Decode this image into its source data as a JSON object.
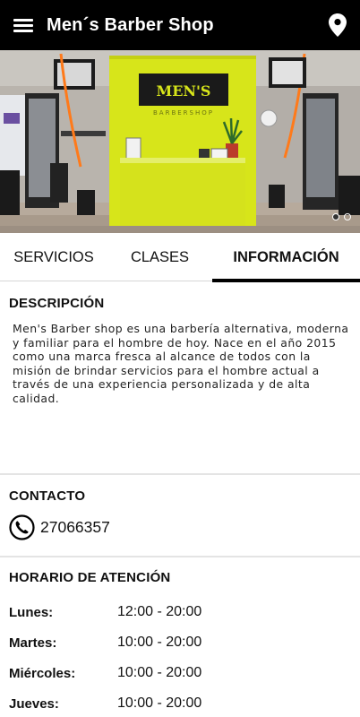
{
  "app": {
    "title": "Men´s Barber Shop"
  },
  "icons": {
    "menu": "menu-icon",
    "location": "location-pin-icon",
    "phone": "phone-icon"
  },
  "hero": {
    "logo_text": "MEN'S",
    "logo_sub": "BARBERSHOP",
    "slides": 2,
    "active_slide": 1,
    "accent": "#d7e51a"
  },
  "tabs": [
    {
      "label": "SERVICIOS"
    },
    {
      "label": "CLASES"
    },
    {
      "label": "INFORMACIÓN"
    }
  ],
  "active_tab": 2,
  "description": {
    "title": "DESCRIPCIÓN",
    "text": "Men's Barber shop es una barbería alternativa, moderna y familiar para el hombre de hoy.  Nace en el año 2015 como una marca fresca al alcance de todos con la misión de brindar servicios para el hombre actual a través de una experiencia personalizada y de alta calidad."
  },
  "contact": {
    "title": "CONTACTO",
    "phone": "27066357"
  },
  "hours": {
    "title": "HORARIO DE ATENCIÓN",
    "rows": [
      {
        "day": "Lunes:",
        "time": "12:00 - 20:00"
      },
      {
        "day": "Martes:",
        "time": "10:00 - 20:00"
      },
      {
        "day": "Miércoles:",
        "time": "10:00 - 20:00"
      },
      {
        "day": "Jueves:",
        "time": "10:00 - 20:00"
      }
    ]
  }
}
